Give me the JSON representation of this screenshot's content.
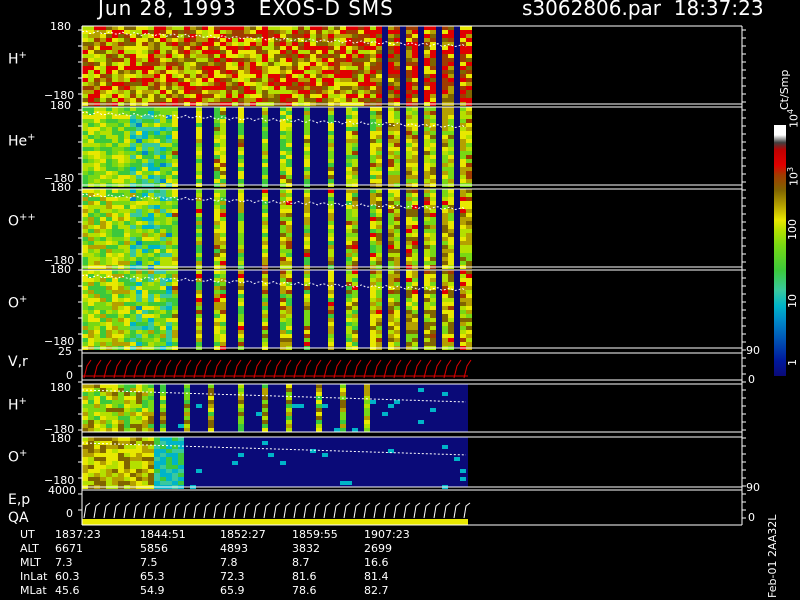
{
  "header": {
    "date_instrument": "Jun 28, 1993   EXOS-D SMS",
    "file_time": "s3062806.par  18:37:23"
  },
  "panels": [
    {
      "id": "h-plus",
      "label": "H",
      "sup": "+",
      "top_tick": "180",
      "bot_tick": "−180"
    },
    {
      "id": "he-plus",
      "label": "He",
      "sup": "+",
      "top_tick": "180",
      "bot_tick": "−180"
    },
    {
      "id": "o-plusplus",
      "label": "O",
      "sup": "++",
      "top_tick": "180",
      "bot_tick": "−180"
    },
    {
      "id": "o-plus",
      "label": "O",
      "sup": "+",
      "top_tick": "180",
      "bot_tick": "−180"
    },
    {
      "id": "vr",
      "label": "V,r",
      "sup": "",
      "top_tick": "25",
      "bot_tick": "0",
      "right_top": "90",
      "right_bot": "0"
    },
    {
      "id": "h-plus-2",
      "label": "H",
      "sup": "+",
      "top_tick": "180",
      "bot_tick": "−180"
    },
    {
      "id": "o-plus-2",
      "label": "O",
      "sup": "+",
      "top_tick": "180",
      "bot_tick": "−180"
    },
    {
      "id": "ep",
      "label": "E,p",
      "sup": "",
      "top_tick": "4000",
      "bot_tick": "0",
      "right_top": "90",
      "right_bot": "0"
    }
  ],
  "qa_label": "QA",
  "colorbar": {
    "title": "Ct/Smp",
    "ticks": [
      {
        "text": "10",
        "sup": "4",
        "value": 10000
      },
      {
        "text": "10",
        "sup": "3",
        "value": 1000
      },
      {
        "text": "100",
        "sup": "",
        "value": 100
      },
      {
        "text": "10",
        "sup": "",
        "value": 10
      },
      {
        "text": "1",
        "sup": "",
        "value": 1
      }
    ],
    "colors": [
      "#0a0a78",
      "#00189c",
      "#0050b4",
      "#0088c8",
      "#00b4c8",
      "#38c8a0",
      "#3cc83c",
      "#78d814",
      "#b4e000",
      "#e8e800",
      "#b4a000",
      "#806400",
      "#a03c00",
      "#e00000",
      "#e00000",
      "#ffffff"
    ]
  },
  "ephemeris": {
    "rows": [
      {
        "label": "UT",
        "values": [
          "1837:23",
          "1844:51",
          "1852:27",
          "1859:55",
          "1907:23"
        ]
      },
      {
        "label": "ALT",
        "values": [
          "6671",
          "5856",
          "4893",
          "3832",
          "2699"
        ]
      },
      {
        "label": "MLT",
        "values": [
          "7.3",
          "7.5",
          "7.8",
          "8.7",
          "16.6"
        ]
      },
      {
        "label": "InLat",
        "values": [
          "60.3",
          "65.3",
          "72.3",
          "81.6",
          "81.4"
        ]
      },
      {
        "label": "MLat",
        "values": [
          "45.6",
          "54.9",
          "65.9",
          "78.6",
          "82.7"
        ]
      }
    ]
  },
  "footer_note": "Feb-01 2AA32L",
  "chart_data": {
    "type": "heatmap",
    "title": "Jun 28, 1993   EXOS-D SMS",
    "x_label": "UT",
    "x_ticks": [
      "1837:23",
      "1844:51",
      "1852:27",
      "1859:55",
      "1907:23"
    ],
    "ion_species": [
      "H+",
      "He+",
      "O++",
      "O+"
    ],
    "y_range_pitch_angle": [
      -180,
      180
    ],
    "colorbar_range_counts": [
      1,
      10000
    ],
    "colorbar_unit": "Ct/Smp",
    "line_panels": [
      {
        "name": "V,r",
        "y_range": [
          0,
          25
        ],
        "right_axis_range": [
          0,
          90
        ]
      },
      {
        "name": "E,p",
        "y_range": [
          0,
          4000
        ],
        "right_axis_range": [
          0,
          90
        ]
      }
    ]
  }
}
